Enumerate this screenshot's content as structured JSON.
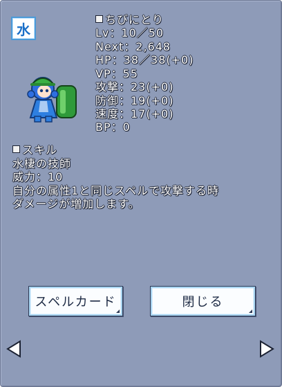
{
  "element": {
    "label": "水"
  },
  "character": {
    "name": "ちびにとり",
    "level": "Lv：10／50",
    "next": "Next：2,648",
    "hp": "HP：38／38(+0)",
    "vp": "VP：55",
    "attack": "攻撃：23(+0)",
    "defense": "防御：19(+0)",
    "speed": "速度：17(+0)",
    "bp": "BP：0"
  },
  "skill": {
    "header": "スキル",
    "name": "水棲の技師",
    "power": "威力：10",
    "desc_line1": "自分の属性1と同じスペルで攻撃する時",
    "desc_line2": "ダメージが増加します。"
  },
  "buttons": {
    "spellcard": "スペルカード",
    "close": "閉じる"
  },
  "colors": {
    "panel": "#8e9bb8",
    "button_face": "#fbfdff",
    "button_border": "#a8d4f0",
    "text": "#ffffff",
    "element_water": "#1a6fc8"
  },
  "icons": {
    "element": "water-element-icon",
    "prev": "left-arrow-icon",
    "next": "right-arrow-icon"
  }
}
